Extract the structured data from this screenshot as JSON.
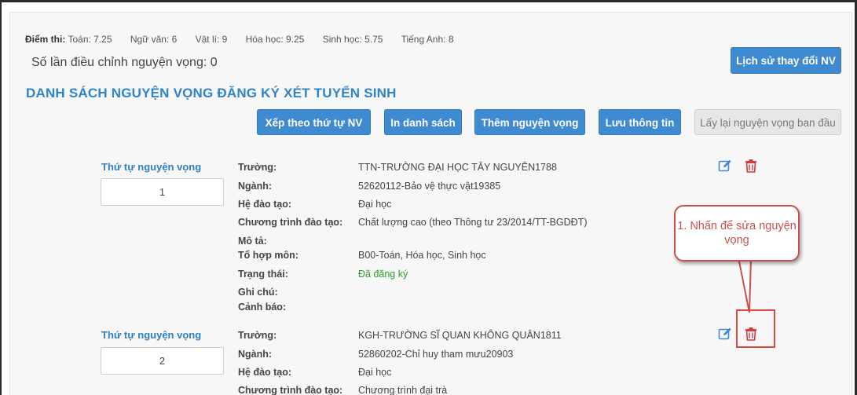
{
  "scores": {
    "label": "Điểm thi:",
    "items": [
      "Toán: 7.25",
      "Ngữ văn: 6",
      "Vật lí: 9",
      "Hóa học: 9.25",
      "Sinh học: 5.75",
      "Tiếng Anh: 8"
    ]
  },
  "adjust_text": "Số lần điều chỉnh nguyện vọng: 0",
  "history_button": "Lịch sử thay đổi NV",
  "list_title": "DANH SÁCH NGUYỆN VỌNG ĐĂNG KÝ XÉT TUYỂN SINH",
  "toolbar": {
    "sort": "Xếp theo thứ tự NV",
    "print": "In danh sách",
    "add": "Thêm nguyện vọng",
    "save": "Lưu thông tin",
    "restore": "Lấy lại nguyện vọng ban đầu"
  },
  "field_labels": {
    "order": "Thứ tự nguyện vọng",
    "school": "Trường:",
    "major": "Ngành:",
    "level": "Hệ đào tạo:",
    "program": "Chương trình đào tạo:",
    "desc": "Mô tả:",
    "combo": "Tổ hợp môn:",
    "status": "Trạng thái:",
    "note": "Ghi chú:",
    "warning": "Cảnh báo:"
  },
  "wishes": [
    {
      "order": "1",
      "school": "TTN-TRƯỜNG ĐẠI HỌC TÂY NGUYÊN1788",
      "major": "52620112-Bảo vệ thực vật19385",
      "level": "Đại học",
      "program": "Chất lượng cao (theo Thông tư 23/2014/TT-BGDĐT)",
      "combo": "B00-Toán, Hóa học, Sinh học",
      "status": "Đã đăng ký"
    },
    {
      "order": "2",
      "school": "KGH-TRƯỜNG SĨ QUAN KHÔNG QUÂN1811",
      "major": "52860202-Chỉ huy tham mưu20903",
      "level": "Đại học",
      "program": "Chương trình đại trà"
    }
  ],
  "callout_text": "1. Nhấn để sửa nguyện vọng",
  "icons": {
    "edit": "edit-icon",
    "delete": "trash-icon"
  },
  "colors": {
    "primary": "#3f8bd1",
    "title": "#2f84c9",
    "status_ok": "#2d9a2d",
    "delete": "#d63a3a",
    "annotation": "#c9504c"
  }
}
